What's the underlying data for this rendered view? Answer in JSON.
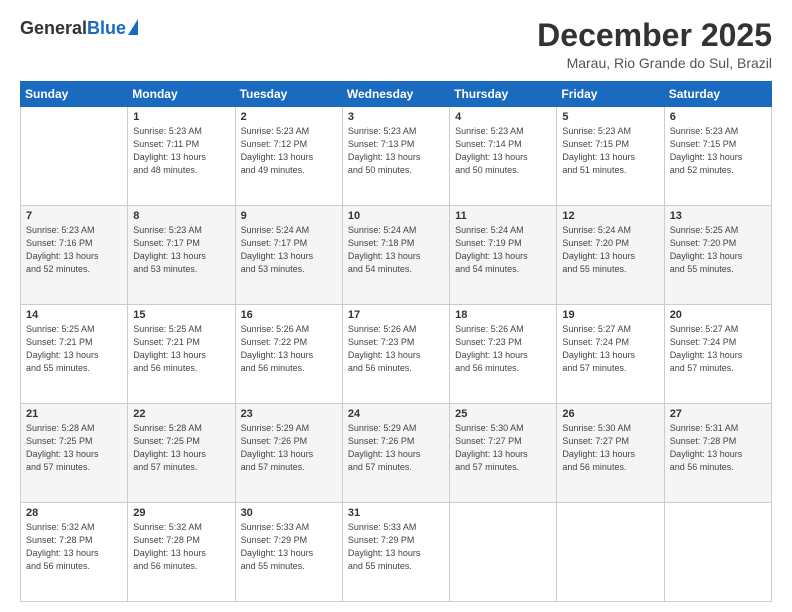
{
  "header": {
    "logo": {
      "part1": "General",
      "part2": "Blue"
    },
    "title": "December 2025",
    "location": "Marau, Rio Grande do Sul, Brazil"
  },
  "days_of_week": [
    "Sunday",
    "Monday",
    "Tuesday",
    "Wednesday",
    "Thursday",
    "Friday",
    "Saturday"
  ],
  "weeks": [
    [
      {
        "num": "",
        "lines": []
      },
      {
        "num": "1",
        "lines": [
          "Sunrise: 5:23 AM",
          "Sunset: 7:11 PM",
          "Daylight: 13 hours",
          "and 48 minutes."
        ]
      },
      {
        "num": "2",
        "lines": [
          "Sunrise: 5:23 AM",
          "Sunset: 7:12 PM",
          "Daylight: 13 hours",
          "and 49 minutes."
        ]
      },
      {
        "num": "3",
        "lines": [
          "Sunrise: 5:23 AM",
          "Sunset: 7:13 PM",
          "Daylight: 13 hours",
          "and 50 minutes."
        ]
      },
      {
        "num": "4",
        "lines": [
          "Sunrise: 5:23 AM",
          "Sunset: 7:14 PM",
          "Daylight: 13 hours",
          "and 50 minutes."
        ]
      },
      {
        "num": "5",
        "lines": [
          "Sunrise: 5:23 AM",
          "Sunset: 7:15 PM",
          "Daylight: 13 hours",
          "and 51 minutes."
        ]
      },
      {
        "num": "6",
        "lines": [
          "Sunrise: 5:23 AM",
          "Sunset: 7:15 PM",
          "Daylight: 13 hours",
          "and 52 minutes."
        ]
      }
    ],
    [
      {
        "num": "7",
        "lines": [
          "Sunrise: 5:23 AM",
          "Sunset: 7:16 PM",
          "Daylight: 13 hours",
          "and 52 minutes."
        ]
      },
      {
        "num": "8",
        "lines": [
          "Sunrise: 5:23 AM",
          "Sunset: 7:17 PM",
          "Daylight: 13 hours",
          "and 53 minutes."
        ]
      },
      {
        "num": "9",
        "lines": [
          "Sunrise: 5:24 AM",
          "Sunset: 7:17 PM",
          "Daylight: 13 hours",
          "and 53 minutes."
        ]
      },
      {
        "num": "10",
        "lines": [
          "Sunrise: 5:24 AM",
          "Sunset: 7:18 PM",
          "Daylight: 13 hours",
          "and 54 minutes."
        ]
      },
      {
        "num": "11",
        "lines": [
          "Sunrise: 5:24 AM",
          "Sunset: 7:19 PM",
          "Daylight: 13 hours",
          "and 54 minutes."
        ]
      },
      {
        "num": "12",
        "lines": [
          "Sunrise: 5:24 AM",
          "Sunset: 7:20 PM",
          "Daylight: 13 hours",
          "and 55 minutes."
        ]
      },
      {
        "num": "13",
        "lines": [
          "Sunrise: 5:25 AM",
          "Sunset: 7:20 PM",
          "Daylight: 13 hours",
          "and 55 minutes."
        ]
      }
    ],
    [
      {
        "num": "14",
        "lines": [
          "Sunrise: 5:25 AM",
          "Sunset: 7:21 PM",
          "Daylight: 13 hours",
          "and 55 minutes."
        ]
      },
      {
        "num": "15",
        "lines": [
          "Sunrise: 5:25 AM",
          "Sunset: 7:21 PM",
          "Daylight: 13 hours",
          "and 56 minutes."
        ]
      },
      {
        "num": "16",
        "lines": [
          "Sunrise: 5:26 AM",
          "Sunset: 7:22 PM",
          "Daylight: 13 hours",
          "and 56 minutes."
        ]
      },
      {
        "num": "17",
        "lines": [
          "Sunrise: 5:26 AM",
          "Sunset: 7:23 PM",
          "Daylight: 13 hours",
          "and 56 minutes."
        ]
      },
      {
        "num": "18",
        "lines": [
          "Sunrise: 5:26 AM",
          "Sunset: 7:23 PM",
          "Daylight: 13 hours",
          "and 56 minutes."
        ]
      },
      {
        "num": "19",
        "lines": [
          "Sunrise: 5:27 AM",
          "Sunset: 7:24 PM",
          "Daylight: 13 hours",
          "and 57 minutes."
        ]
      },
      {
        "num": "20",
        "lines": [
          "Sunrise: 5:27 AM",
          "Sunset: 7:24 PM",
          "Daylight: 13 hours",
          "and 57 minutes."
        ]
      }
    ],
    [
      {
        "num": "21",
        "lines": [
          "Sunrise: 5:28 AM",
          "Sunset: 7:25 PM",
          "Daylight: 13 hours",
          "and 57 minutes."
        ]
      },
      {
        "num": "22",
        "lines": [
          "Sunrise: 5:28 AM",
          "Sunset: 7:25 PM",
          "Daylight: 13 hours",
          "and 57 minutes."
        ]
      },
      {
        "num": "23",
        "lines": [
          "Sunrise: 5:29 AM",
          "Sunset: 7:26 PM",
          "Daylight: 13 hours",
          "and 57 minutes."
        ]
      },
      {
        "num": "24",
        "lines": [
          "Sunrise: 5:29 AM",
          "Sunset: 7:26 PM",
          "Daylight: 13 hours",
          "and 57 minutes."
        ]
      },
      {
        "num": "25",
        "lines": [
          "Sunrise: 5:30 AM",
          "Sunset: 7:27 PM",
          "Daylight: 13 hours",
          "and 57 minutes."
        ]
      },
      {
        "num": "26",
        "lines": [
          "Sunrise: 5:30 AM",
          "Sunset: 7:27 PM",
          "Daylight: 13 hours",
          "and 56 minutes."
        ]
      },
      {
        "num": "27",
        "lines": [
          "Sunrise: 5:31 AM",
          "Sunset: 7:28 PM",
          "Daylight: 13 hours",
          "and 56 minutes."
        ]
      }
    ],
    [
      {
        "num": "28",
        "lines": [
          "Sunrise: 5:32 AM",
          "Sunset: 7:28 PM",
          "Daylight: 13 hours",
          "and 56 minutes."
        ]
      },
      {
        "num": "29",
        "lines": [
          "Sunrise: 5:32 AM",
          "Sunset: 7:28 PM",
          "Daylight: 13 hours",
          "and 56 minutes."
        ]
      },
      {
        "num": "30",
        "lines": [
          "Sunrise: 5:33 AM",
          "Sunset: 7:29 PM",
          "Daylight: 13 hours",
          "and 55 minutes."
        ]
      },
      {
        "num": "31",
        "lines": [
          "Sunrise: 5:33 AM",
          "Sunset: 7:29 PM",
          "Daylight: 13 hours",
          "and 55 minutes."
        ]
      },
      {
        "num": "",
        "lines": []
      },
      {
        "num": "",
        "lines": []
      },
      {
        "num": "",
        "lines": []
      }
    ]
  ]
}
